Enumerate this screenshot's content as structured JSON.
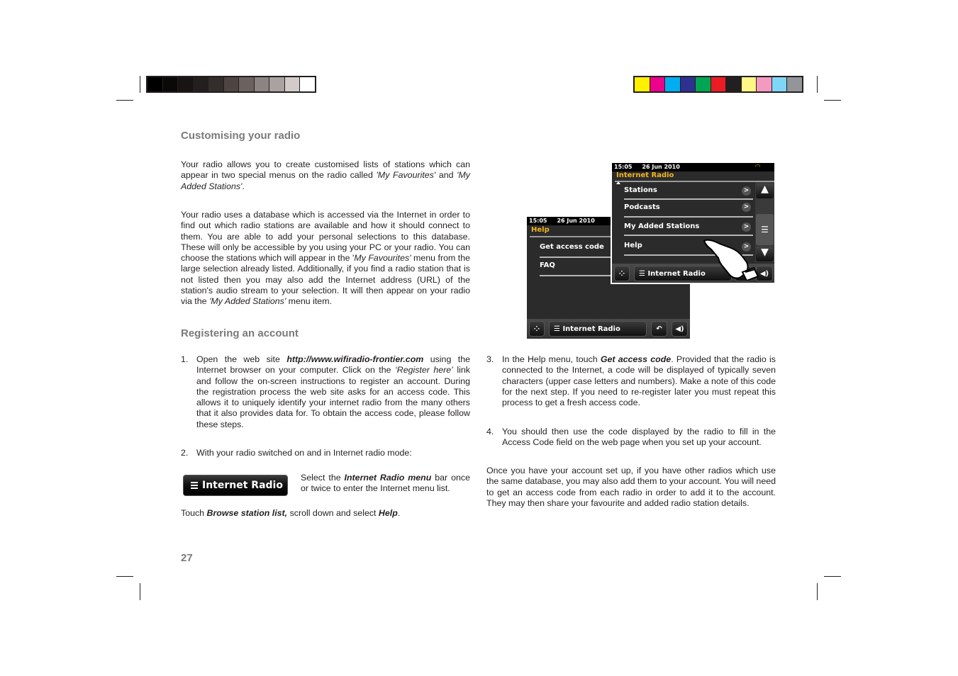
{
  "color_bars": {
    "grayscale": [
      "#000000",
      "#0a0908",
      "#171413",
      "#231f1e",
      "#332d2b",
      "#4e4543",
      "#6b6260",
      "#8c8482",
      "#aaa2a0",
      "#d2cbca",
      "#ffffff"
    ],
    "process": [
      "#fff100",
      "#ec008c",
      "#00aeef",
      "#2e3192",
      "#00a651",
      "#ed1c24",
      "#231f20",
      "#fff685",
      "#f49ac1",
      "#7fd7f7",
      "#939598"
    ]
  },
  "section1": {
    "heading": "Customising your radio",
    "para1": {
      "t1": "Your radio allows you to create customised lists of stations which can appear in two special menus on the radio called ",
      "i1": "'My Favourites'",
      "t2": " and ",
      "i2": "'My Added Stations'",
      "t3": "."
    },
    "para2": {
      "t1": "Your radio uses a database which is accessed via the Internet in order to find out which radio stations are available and how it should connect to them. You are able to add your personal selections to this database. These will only be accessible by you using your PC or your radio. You can choose the stations which will appear in the '",
      "i1": "My Favourites'",
      "t2": " menu from the large selection already listed.  Additionally, if you find a radio station that is not listed then you may also add the Internet address (URL) of the station's audio stream to your selection. It will then appear on your radio via the ",
      "i2": "'My Added Stations'",
      "t3": " menu item."
    }
  },
  "section2": {
    "heading": "Registering an account",
    "step1": {
      "num": "1.",
      "t1": "Open the web site ",
      "b1": "http://www.wifiradio-frontier.com",
      "t2": " using the Internet browser on your computer. Click on the ",
      "i1": "‘Register here’",
      "t3": " link and follow the on-screen instructions to register an account. During the registration process the web site asks for an access code. This allows it to uniquely identify your internet radio from the many others that it also provides data for. To obtain the access code, please follow these steps."
    },
    "step2": {
      "num": "2.",
      "text": "With your radio switched on and in Internet radio mode:"
    },
    "ir_button_label": "Internet Radio",
    "select_note": {
      "t1": "Select the ",
      "b1": "Internet Radio menu",
      "t2": " bar once or twice to enter the Internet menu list."
    },
    "touch_note": {
      "t1": "Touch ",
      "b1": "Browse station list,",
      "t2": " scroll down and select ",
      "b2": "Help",
      "t3": "."
    },
    "step3": {
      "num": "3.",
      "t1": "In the Help menu, touch ",
      "b1": "Get access code",
      "t2": ". Provided that the radio is connected to the Internet, a code will be displayed of typically seven characters (upper case letters and numbers). Make a note of this code for the next step. If you need to re-register later you must repeat this process to get a fresh access code."
    },
    "step4": {
      "num": "4.",
      "text": "You should then use the code displayed by the radio to fill in the Access Code field on the web page when you set up your account."
    },
    "closing": "Once you have your account set up, if you have other radios which use the same database, you may also add them to your account. You will need to get an access code from each radio in order to add it to the account. They may then share your favourite and added radio station details."
  },
  "screen_help": {
    "time": "15:05",
    "date": "26 Jun 2010",
    "title": "Help",
    "items": [
      "Get access code",
      "FAQ"
    ],
    "bottom_label": "Internet Radio"
  },
  "screen_internet": {
    "time": "15:05",
    "date": "26 Jun 2010",
    "title": "Internet Radio",
    "items": [
      "Stations",
      "Podcasts",
      "My Added Stations",
      "Help"
    ],
    "chevron": ">",
    "bottom_label": "Internet Radio"
  },
  "page_number": "27",
  "colors": {
    "heading_gray": "#7a7a7a",
    "screen_title": "#f2b420"
  }
}
